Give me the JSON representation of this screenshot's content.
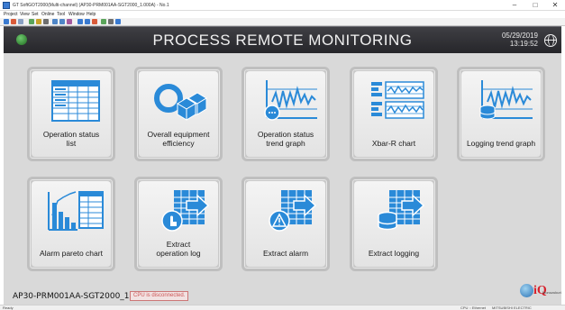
{
  "window": {
    "title": "GT SoftGOT2000(Multi-channel) (AP30-PRM001AA-SGT2000_1.000A) - No.1",
    "minimize": "–",
    "maximize": "□",
    "close": "✕"
  },
  "menu": [
    "Project",
    "View",
    "Set",
    "Online",
    "Tool",
    "Window",
    "Help"
  ],
  "header": {
    "title": "PROCESS REMOTE MONITORING",
    "date": "05/29/2019",
    "time": "13:19:52"
  },
  "tiles": [
    {
      "label": "Operation status\nlist",
      "icon": "operation-status-list-icon"
    },
    {
      "label": "Overall equipment\nefficiency",
      "icon": "overall-equipment-efficiency-icon"
    },
    {
      "label": "Operation status\ntrend graph",
      "icon": "operation-status-trend-graph-icon"
    },
    {
      "label": "Xbar-R chart",
      "icon": "xbar-r-chart-icon"
    },
    {
      "label": "Logging trend graph",
      "icon": "logging-trend-graph-icon"
    },
    {
      "label": "Alarm pareto chart",
      "icon": "alarm-pareto-chart-icon"
    },
    {
      "label": "Extract\noperation log",
      "icon": "extract-operation-log-icon"
    },
    {
      "label": "Extract alarm",
      "icon": "extract-alarm-icon"
    },
    {
      "label": "Extract logging",
      "icon": "extract-logging-icon"
    }
  ],
  "status": {
    "device": "AP30-PRM001AA-SGT2000_1.000A",
    "cpu": "CPU is disconnected."
  },
  "logo": {
    "text": "iQ",
    "sub": "Monozukuri"
  },
  "footer": {
    "left": "Ready",
    "connection": "CPU :: Ethernet",
    "vendor": "MITSUBISHI ELECTRIC"
  },
  "colors": {
    "accent_blue": "#2a8ad8",
    "header_dark": "#2e2e33",
    "panel_gray": "#d9d9d9"
  }
}
